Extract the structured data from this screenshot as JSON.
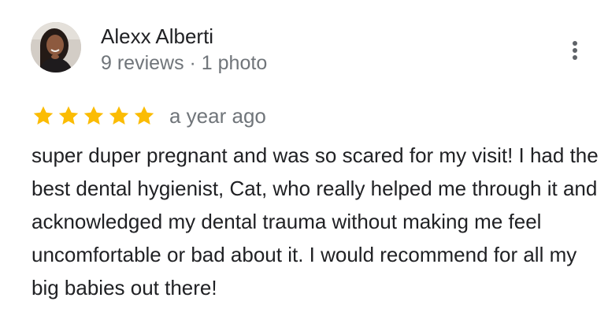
{
  "review": {
    "author": {
      "name": "Alexx Alberti",
      "meta": "9 reviews · 1 photo",
      "avatar_icon": "user-photo-avatar"
    },
    "menu_icon": "more-vertical-icon",
    "rating": {
      "value": 5,
      "max": 5,
      "star_color": "#fbbc04"
    },
    "date": "a year ago",
    "text": "super duper pregnant and was so scared for my visit! I had the best dental hygienist, Cat, who really helped me through it and acknowledged my dental trauma without making me feel uncomfortable or bad about it. I would recommend for all my big babies out there!"
  }
}
